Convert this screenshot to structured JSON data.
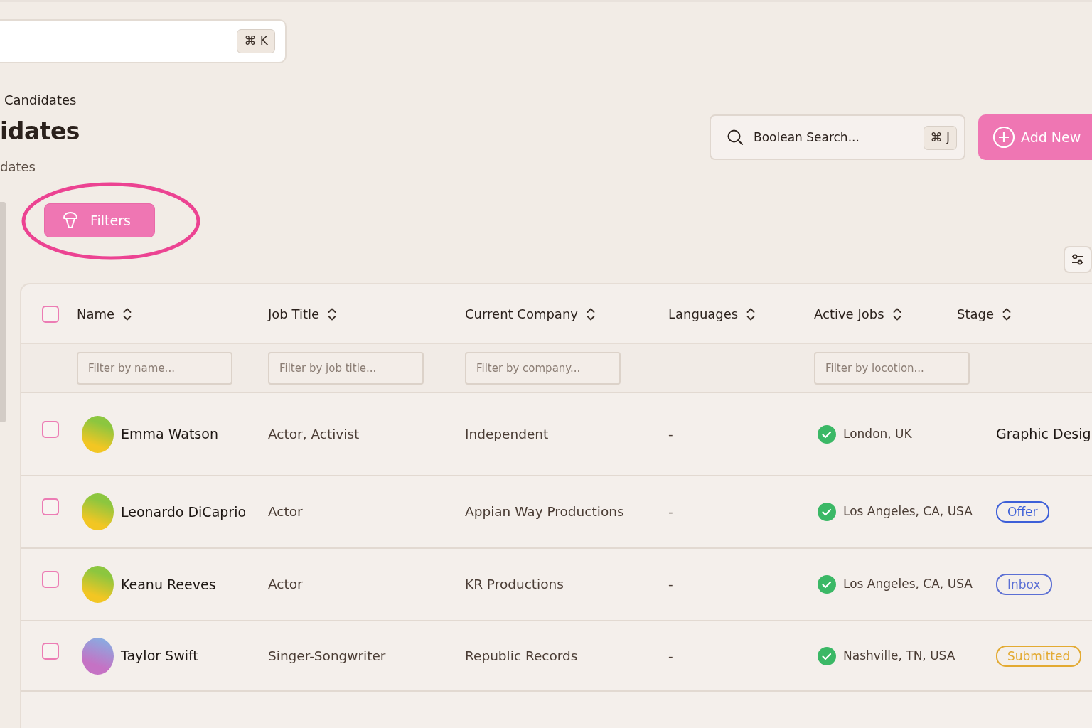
{
  "command_search": {
    "shortcut": "⌘ K"
  },
  "breadcrumb": "Candidates",
  "title": "idates",
  "subtitle": "dates",
  "boolean_search": {
    "placeholder": "Boolean Search...",
    "shortcut": "⌘ J"
  },
  "add_button": "Add New",
  "filters_button": "Filters",
  "table": {
    "header_checked": false,
    "columns": [
      {
        "label": "Name",
        "filter_placeholder": "Filter by name..."
      },
      {
        "label": "Job Title",
        "filter_placeholder": "Filter by job title..."
      },
      {
        "label": "Current Company",
        "filter_placeholder": "Filter by company..."
      },
      {
        "label": "Languages"
      },
      {
        "label": "Active Jobs",
        "filter_placeholder": "Filter by locotion..."
      },
      {
        "label": "Stage"
      }
    ],
    "rows": [
      {
        "checked": false,
        "color": "#8cc63f",
        "name": "Emma Watson",
        "job_title": "Actor, Activist",
        "company": "Independent",
        "languages": "-",
        "location": "London, UK",
        "stage": {
          "kind": "text",
          "label": "Graphic Desig"
        }
      },
      {
        "checked": false,
        "color": "#8cc63f",
        "name": "Leonardo DiCaprio",
        "job_title": "Actor",
        "company": "Appian Way Productions",
        "languages": "-",
        "location": "Los Angeles, CA, USA",
        "stage": {
          "kind": "badge",
          "label": "Offer",
          "color": "#3d5fd8"
        }
      },
      {
        "checked": false,
        "color": "#8cc63f",
        "name": "Keanu Reeves",
        "job_title": "Actor",
        "company": "KR Productions",
        "languages": "-",
        "location": "Los Angeles, CA, USA",
        "stage": {
          "kind": "badge",
          "label": "Inbox",
          "color": "#5b6fd4"
        }
      },
      {
        "checked": false,
        "color": "#c572c4",
        "name": "Taylor Swift",
        "job_title": "Singer-Songwriter",
        "company": "Republic Records",
        "languages": "-",
        "location": "Nashville, TN, USA",
        "stage": {
          "kind": "badge",
          "label": "Submitted",
          "color": "#e3aa32"
        }
      }
    ]
  }
}
